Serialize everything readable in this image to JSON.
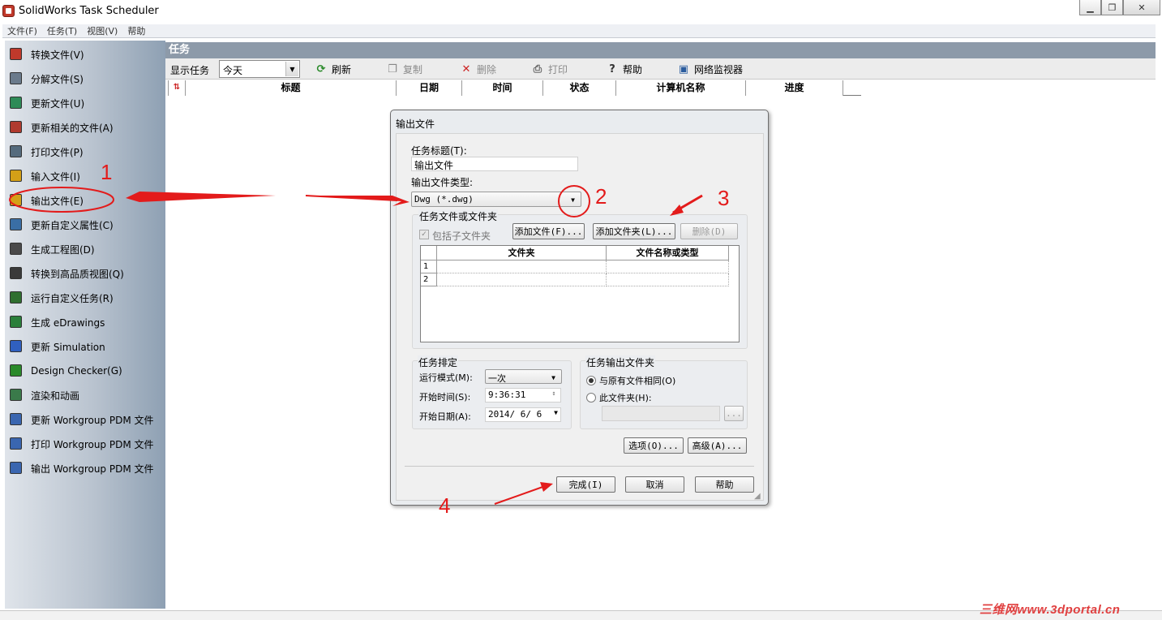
{
  "window": {
    "title": "SolidWorks Task Scheduler"
  },
  "menu": [
    "文件(F)",
    "任务(T)",
    "视图(V)",
    "帮助"
  ],
  "sidebar": {
    "items": [
      {
        "label": "转换文件(V)",
        "icon": "convert-icon"
      },
      {
        "label": "分解文件(S)",
        "icon": "tools-icon"
      },
      {
        "label": "更新文件(U)",
        "icon": "update-icon"
      },
      {
        "label": "更新相关的文件(A)",
        "icon": "update-related-icon"
      },
      {
        "label": "打印文件(P)",
        "icon": "printer-icon"
      },
      {
        "label": "输入文件(I)",
        "icon": "import-icon"
      },
      {
        "label": "输出文件(E)",
        "icon": "export-icon"
      },
      {
        "label": "更新自定义属性(C)",
        "icon": "properties-icon"
      },
      {
        "label": "生成工程图(D)",
        "icon": "drawing-icon"
      },
      {
        "label": "转换到高品质视图(Q)",
        "icon": "hq-view-icon"
      },
      {
        "label": "运行自定义任务(R)",
        "icon": "custom-task-icon"
      },
      {
        "label": "生成 eDrawings",
        "icon": "edrawings-icon"
      },
      {
        "label": "更新 Simulation",
        "icon": "simulation-icon"
      },
      {
        "label": "Design Checker(G)",
        "icon": "design-checker-icon"
      },
      {
        "label": "渲染和动画",
        "icon": "render-icon"
      },
      {
        "label": "更新 Workgroup PDM 文件",
        "icon": "pdm-update-icon"
      },
      {
        "label": "打印 Workgroup PDM 文件",
        "icon": "pdm-print-icon"
      },
      {
        "label": "输出 Workgroup PDM 文件",
        "icon": "pdm-export-icon"
      }
    ]
  },
  "main": {
    "header": "任务",
    "toolbar": {
      "show_label": "显示任务",
      "show_value": "今天",
      "buttons": [
        {
          "label": "刷新",
          "icon": "refresh-icon"
        },
        {
          "label": "复制",
          "icon": "copy-icon"
        },
        {
          "label": "删除",
          "icon": "delete-icon"
        },
        {
          "label": "打印",
          "icon": "print-icon"
        },
        {
          "label": "帮助",
          "icon": "help-icon"
        },
        {
          "label": "网络监视器",
          "icon": "network-monitor-icon"
        }
      ]
    },
    "columns": [
      "标题",
      "日期",
      "时间",
      "状态",
      "计算机名称",
      "进度"
    ]
  },
  "dialog": {
    "title": "输出文件",
    "task_title_label": "任务标题(T):",
    "task_title_value": "输出文件",
    "file_type_label": "输出文件类型:",
    "file_type_value": "Dwg (*.dwg)",
    "files_group": "任务文件或文件夹",
    "include_subfolders": "包括子文件夹",
    "add_file": "添加文件(F)...",
    "add_folder": "添加文件夹(L)...",
    "delete": "删除(D)",
    "table_columns": [
      "文件夹",
      "文件名称或类型"
    ],
    "rows": [
      "1",
      "2"
    ],
    "schedule_group": "任务排定",
    "run_mode_label": "运行模式(M):",
    "run_mode_value": "一次",
    "start_time_label": "开始时间(S):",
    "start_time_value": "9:36:31",
    "start_date_label": "开始日期(A):",
    "start_date_value": "2014/ 6/ 6",
    "output_group": "任务输出文件夹",
    "same_as_original": "与原有文件相同(O)",
    "this_folder": "此文件夹(H):",
    "browse": "...",
    "options": "选项(O)...",
    "advanced": "高级(A)...",
    "finish": "完成(I)",
    "cancel": "取消",
    "help": "帮助"
  },
  "annotations": [
    "1",
    "2",
    "3",
    "4"
  ],
  "watermark": "三维网www.3dportal.cn",
  "colors": {
    "annotation": "#e31b1b",
    "task_header": "#8d9aa9"
  }
}
